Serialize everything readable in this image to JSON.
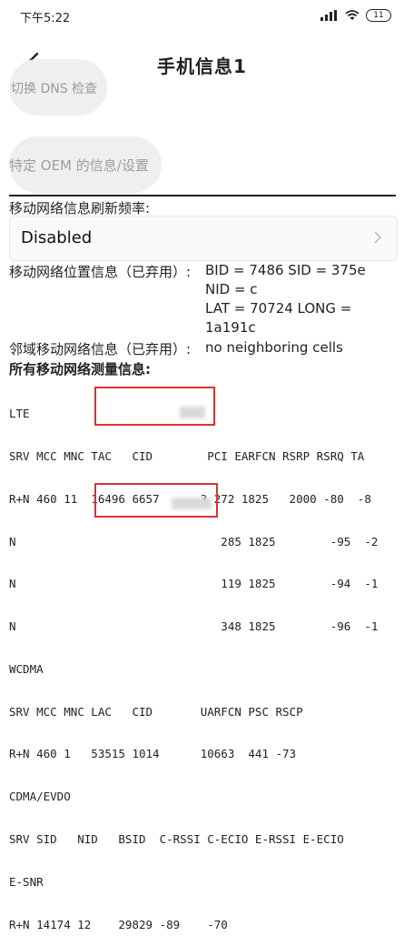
{
  "status_bar": {
    "time": "下午5:22",
    "battery": "11"
  },
  "header": {
    "title": "手机信息1"
  },
  "buttons": {
    "dns_check": "切换 DNS 检查",
    "oem_info": "特定 OEM 的信息/设置"
  },
  "refresh_rate": {
    "label": "移动网络信息刷新频率:",
    "value": "Disabled"
  },
  "location": {
    "label": "移动网络位置信息（已弃用）:",
    "line1": "BID = 7486   SID = 375e",
    "line2": "NID = c",
    "line3": "LAT = 70724   LONG =",
    "line4": "1a191c"
  },
  "neighbor": {
    "label": "邻域移动网络信息（已弃用）:",
    "value": "no neighboring cells"
  },
  "measurement": {
    "label": "所有移动网络测量信息:"
  },
  "cell_table": {
    "lines": [
      "LTE",
      "SRV MCC MNC TAC   CID        PCI EARFCN RSRP RSRQ TA",
      "R+N 460 11  16496 6657      3 272 1825   2000 -80  -8",
      "N                              285 1825        -95  -2",
      "N                              119 1825        -94  -1",
      "N                              348 1825        -96  -1",
      "WCDMA",
      "SRV MCC MNC LAC   CID       UARFCN PSC RSCP",
      "R+N 460 1   53515 1014      10663  441 -73",
      "CDMA/EVDO",
      "SRV SID   NID   BSID  C-RSSI C-ECIO E-RSSI E-ECIO",
      "E-SNR",
      "R+N 14174 12    29829 -89    -70"
    ]
  },
  "colors": {
    "highlight": "#d8342f",
    "pill_bg": "#efefef"
  }
}
